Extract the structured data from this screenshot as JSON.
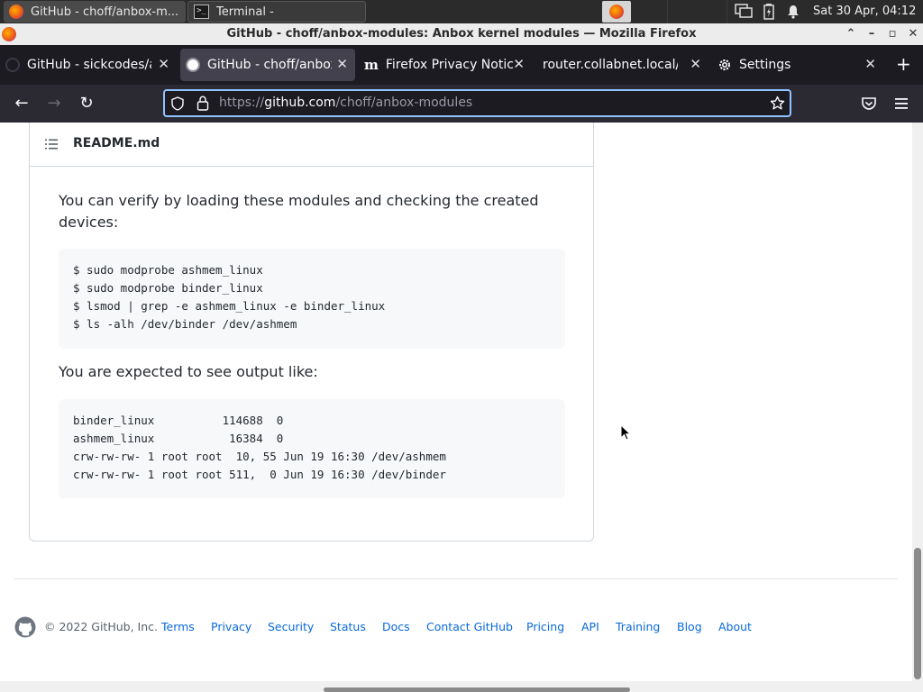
{
  "system_panel": {
    "tasks": [
      {
        "label": "GitHub - choff/anbox-m...",
        "icon": "firefox-icon"
      },
      {
        "label": "Terminal -",
        "icon": "terminal-icon"
      }
    ],
    "clock": "Sat 30 Apr, 04:12"
  },
  "window": {
    "title": "GitHub - choff/anbox-modules: Anbox kernel modules — Mozilla Firefox"
  },
  "tabs": [
    {
      "label": "GitHub - sickcodes/an",
      "icon": "github-icon"
    },
    {
      "label": "GitHub - choff/anbox",
      "icon": "github-icon",
      "active": true
    },
    {
      "label": "Firefox Privacy Notice",
      "icon": "m-icon",
      "icon_glyph": "m"
    },
    {
      "label": "router.collabnet.local/",
      "icon": ""
    },
    {
      "label": "Settings",
      "icon": "gear-icon"
    }
  ],
  "navbar": {
    "url_prefix": "https://",
    "url_host": "github.com",
    "url_path": "/choff/anbox-modules"
  },
  "readme": {
    "title": "README.md",
    "para1": "You can verify by loading these modules and checking the created devices:",
    "code1": [
      "$ sudo modprobe ashmem_linux",
      "$ sudo modprobe binder_linux",
      "$ lsmod | grep -e ashmem_linux -e binder_linux",
      "$ ls -alh /dev/binder /dev/ashmem"
    ],
    "para2": "You are expected to see output like:",
    "code2": [
      "binder_linux          114688  0",
      "ashmem_linux           16384  0",
      "crw-rw-rw- 1 root root  10, 55 Jun 19 16:30 /dev/ashmem",
      "crw-rw-rw- 1 root root 511,  0 Jun 19 16:30 /dev/binder"
    ]
  },
  "footer": {
    "copyright": "© 2022 GitHub, Inc.",
    "links": [
      "Terms",
      "Privacy",
      "Security",
      "Status",
      "Docs",
      "Contact GitHub",
      "Pricing",
      "API",
      "Training",
      "Blog",
      "About"
    ]
  },
  "colors": {
    "link": "#0969da",
    "tabbar_bg": "#1c1b22",
    "urlbar_focus": "#8fc2ff"
  }
}
